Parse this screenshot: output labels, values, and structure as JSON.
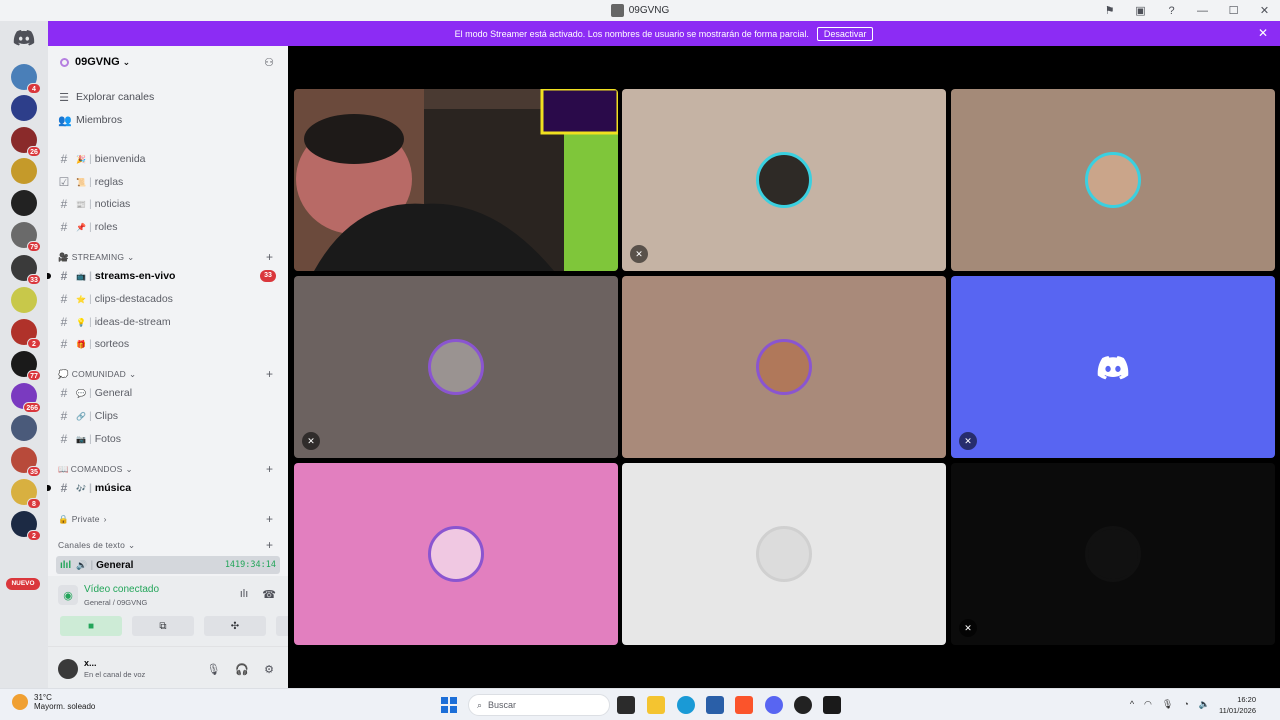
{
  "window": {
    "title": "09GVNG",
    "controls": [
      "⚑",
      "▣",
      "?",
      "—",
      "☐",
      "✕"
    ]
  },
  "banner": {
    "text": "El modo Streamer está activado. Los nombres de usuario se mostrarán de forma parcial.",
    "button": "Desactivar"
  },
  "rail": {
    "badges": [
      "4",
      "26",
      "79",
      "33",
      "2",
      "77",
      "266",
      "35",
      "8",
      "2"
    ],
    "new_label": "NUEVO"
  },
  "server": {
    "name": "09GVNG",
    "nav": [
      {
        "label": "Explorar canales",
        "icon": "browse-icon"
      },
      {
        "label": "Miembros",
        "icon": "members-icon"
      }
    ],
    "channels_top": [
      {
        "label": "bienvenida",
        "emoji": "🎉"
      },
      {
        "label": "reglas",
        "emoji": "📜"
      },
      {
        "label": "noticias",
        "emoji": "📰"
      },
      {
        "label": "roles",
        "emoji": "📌"
      }
    ],
    "categories": {
      "streaming": "STREAMING",
      "comunidad": "COMUNIDAD",
      "comandos": "COMANDOS",
      "private": "Private",
      "texto": "Canales de texto"
    },
    "streaming_channels": [
      {
        "label": "streams-en-vivo",
        "emoji": "📺",
        "count": "33"
      },
      {
        "label": "clips-destacados",
        "emoji": "⭐"
      },
      {
        "label": "ideas-de-stream",
        "emoji": "💡"
      },
      {
        "label": "sorteos",
        "emoji": "🎁"
      }
    ],
    "comunidad_channels": [
      {
        "label": "General",
        "emoji": "💬"
      },
      {
        "label": "Clips",
        "emoji": "🔗"
      },
      {
        "label": "Fotos",
        "emoji": "📷"
      }
    ],
    "comandos_channels": [
      {
        "label": "música",
        "emoji": "🎶"
      }
    ],
    "voice_channel": {
      "label": "General",
      "timer": "1419:34:14"
    }
  },
  "voice_panel": {
    "status": "Vídeo conectado",
    "location": "General / 09GVNG",
    "buttons": [
      "camera",
      "screen-share",
      "activities",
      "soundboard"
    ]
  },
  "user": {
    "name": "x...",
    "status": "En el canal de voz"
  },
  "tiles": [
    {
      "bg": "#3c2a22",
      "type": "camera"
    },
    {
      "bg": "#c5b3a4",
      "avatar": "#2e2a26",
      "ring": "#3ad0e0",
      "mute": true
    },
    {
      "bg": "#a48a78",
      "avatar": "#caa58a",
      "ring": "#3ad0e0"
    },
    {
      "bg": "#6c6260",
      "avatar": "#9a9391",
      "ring": "#8a55d0",
      "mute": true
    },
    {
      "bg": "#a98a7a",
      "avatar": "#b0785a",
      "ring": "#8a55d0"
    },
    {
      "bg": "#5865f2",
      "type": "discord",
      "mute": true
    },
    {
      "bg": "#e27fbf",
      "avatar": "#f0c8e2",
      "ring": "#8a55d0"
    },
    {
      "bg": "#e7e7e7",
      "avatar": "#dcdcdc",
      "ring": "#d0d0d0"
    },
    {
      "bg": "#0b0b0b",
      "avatar": "#111111",
      "ring": "#111111",
      "mute": true
    }
  ],
  "taskbar": {
    "weather_temp": "31°C",
    "weather_desc": "Mayorm. soleado",
    "search_placeholder": "Buscar",
    "time": "16:20",
    "date": "11/01/2026"
  }
}
